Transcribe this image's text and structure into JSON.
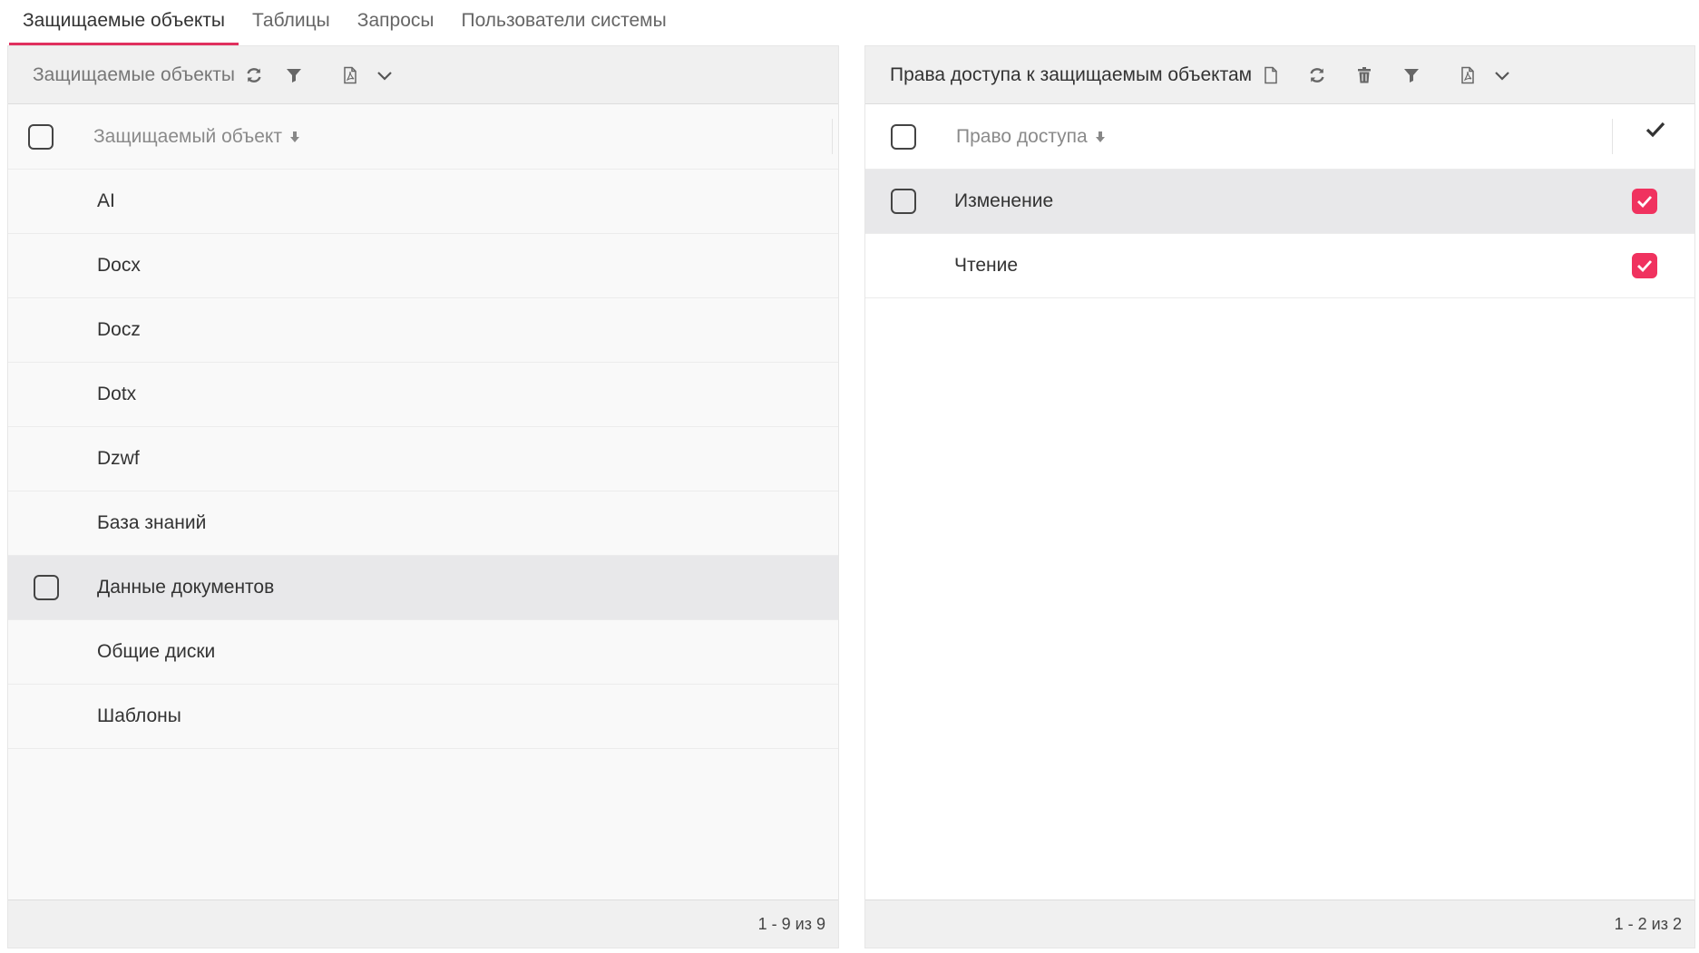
{
  "tabs": [
    {
      "label": "Защищаемые объекты",
      "active": true
    },
    {
      "label": "Таблицы",
      "active": false
    },
    {
      "label": "Запросы",
      "active": false
    },
    {
      "label": "Пользователи системы",
      "active": false
    }
  ],
  "left_panel": {
    "title": "Защищаемые объекты",
    "toolbar_icons": [
      "refresh-icon",
      "filter-icon",
      "pdf-export-icon",
      "chevron-down-icon"
    ],
    "column_header": "Защищаемый объект",
    "rows": [
      {
        "label": "AI"
      },
      {
        "label": "Docx"
      },
      {
        "label": "Docz"
      },
      {
        "label": "Dotx"
      },
      {
        "label": "Dzwf"
      },
      {
        "label": "База знаний"
      },
      {
        "label": "Данные документов",
        "hovered": true
      },
      {
        "label": "Общие диски"
      },
      {
        "label": "Шаблоны"
      }
    ],
    "pagination": "1 - 9 из 9"
  },
  "right_panel": {
    "title": "Права доступа к защищаемым объектам",
    "toolbar_icons": [
      "new-document-icon",
      "refresh-icon",
      "trash-icon",
      "filter-icon",
      "pdf-export-icon",
      "chevron-down-icon"
    ],
    "column_header": "Право доступа",
    "rows": [
      {
        "label": "Изменение",
        "checked": true,
        "hovered": true
      },
      {
        "label": "Чтение",
        "checked": true
      }
    ],
    "pagination": "1 - 2 из 2"
  },
  "colors": {
    "accent": "#e0305e",
    "checkbox_checked": "#f0325f",
    "toolbar_bg": "#f0f0f0",
    "row_hover": "#e8e8ea"
  }
}
